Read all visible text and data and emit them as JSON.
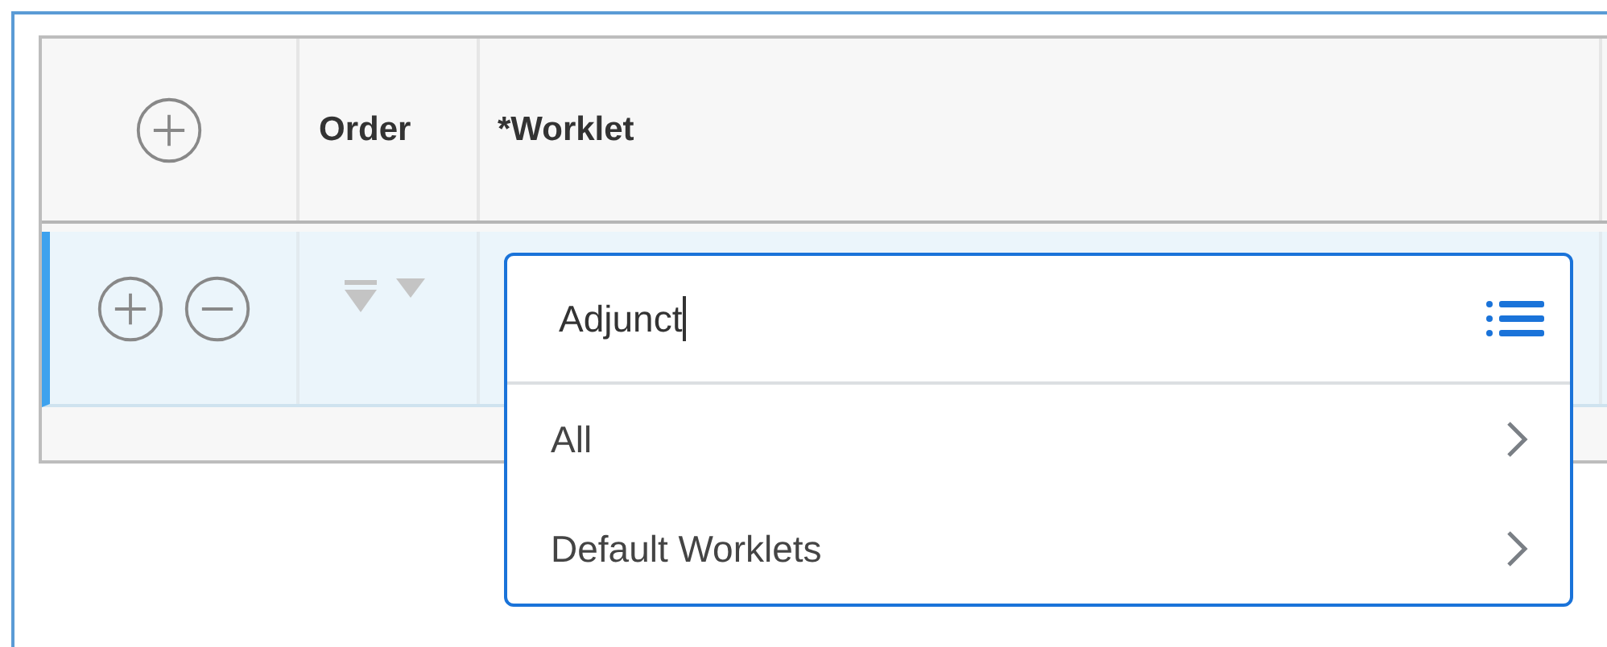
{
  "table": {
    "columns": [
      {
        "kind": "add"
      },
      {
        "kind": "text",
        "label": "Order"
      },
      {
        "kind": "text",
        "label": "*Worklet"
      }
    ],
    "rows": [
      {
        "selected": true
      }
    ]
  },
  "worklet_field": {
    "value": "Adjunct"
  },
  "dropdown": {
    "options": [
      {
        "label": "All"
      },
      {
        "label": "Default Worklets"
      }
    ]
  }
}
